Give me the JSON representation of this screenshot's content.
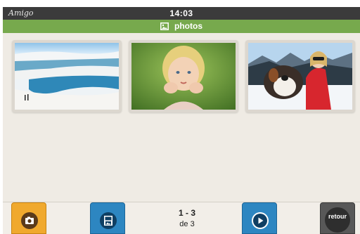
{
  "status": {
    "brand": "Amigo",
    "time": "14:03"
  },
  "header": {
    "title": "photos",
    "icon": "image-icon"
  },
  "gallery": {
    "photos": [
      {
        "name": "dunes-lagoon-photo"
      },
      {
        "name": "girl-portrait-photo"
      },
      {
        "name": "girl-with-dog-photo"
      }
    ]
  },
  "pager": {
    "range": "1 - 3",
    "total": "de 3"
  },
  "toolbar": {
    "camera_icon": "camera-icon",
    "save_icon": "save-photo-icon",
    "play_icon": "play-icon",
    "back_label": "retour"
  },
  "colors": {
    "status_bar": "#3b3b3b",
    "title_bar": "#77a94d",
    "camera_button": "#f0a92e",
    "blue_button": "#2d86c1",
    "back_button": "#585858"
  }
}
